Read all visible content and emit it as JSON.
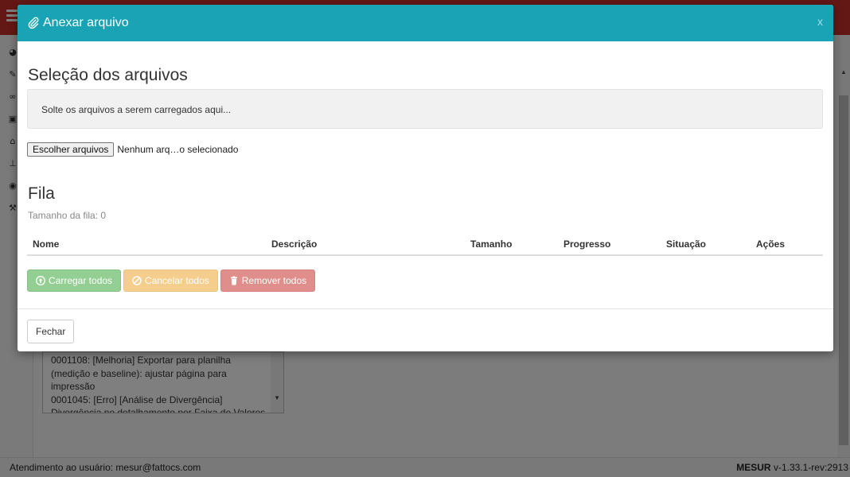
{
  "modal": {
    "title": "Anexar arquivo",
    "close_label": "x",
    "selection_title": "Seleção dos arquivos",
    "drop_zone_text": "Solte os arquivos a serem carregados aqui...",
    "file_button_label": "Escolher arquivos",
    "file_status": "Nenhum arq…o selecionado",
    "queue_title": "Fila",
    "queue_size_text": "Tamanho da fila: 0",
    "table_headers": [
      "Nome",
      "Descrição",
      "Tamanho",
      "Progresso",
      "Situação",
      "Ações"
    ],
    "buttons": {
      "upload_all": "Carregar todos",
      "cancel_all": "Cancelar todos",
      "remove_all": "Remover todos"
    },
    "footer_close_label": "Fechar"
  },
  "background": {
    "textarea_lines": [
      "0001108: [Melhoria] Exportar para planilha",
      "(medição e baseline): ajustar página para",
      "impressão",
      "0001045: [Erro] [Análise de Divergência]",
      "Divergência no detalhamento por Faixa de Valores"
    ],
    "footer_left": "Atendimento ao usuário: mesur@fattocs.com",
    "footer_app_name": "MESUR",
    "footer_version": " v-1.33.1-rev:2913"
  },
  "colors": {
    "header": "#1aa3b4",
    "topbar": "#c9302c",
    "success": "#93cf93",
    "warning": "#f5cd8d",
    "danger": "#e08e8b"
  },
  "icons": {
    "title": "paperclip-icon",
    "upload": "upload-circle-icon",
    "cancel": "ban-icon",
    "remove": "trash-icon"
  }
}
